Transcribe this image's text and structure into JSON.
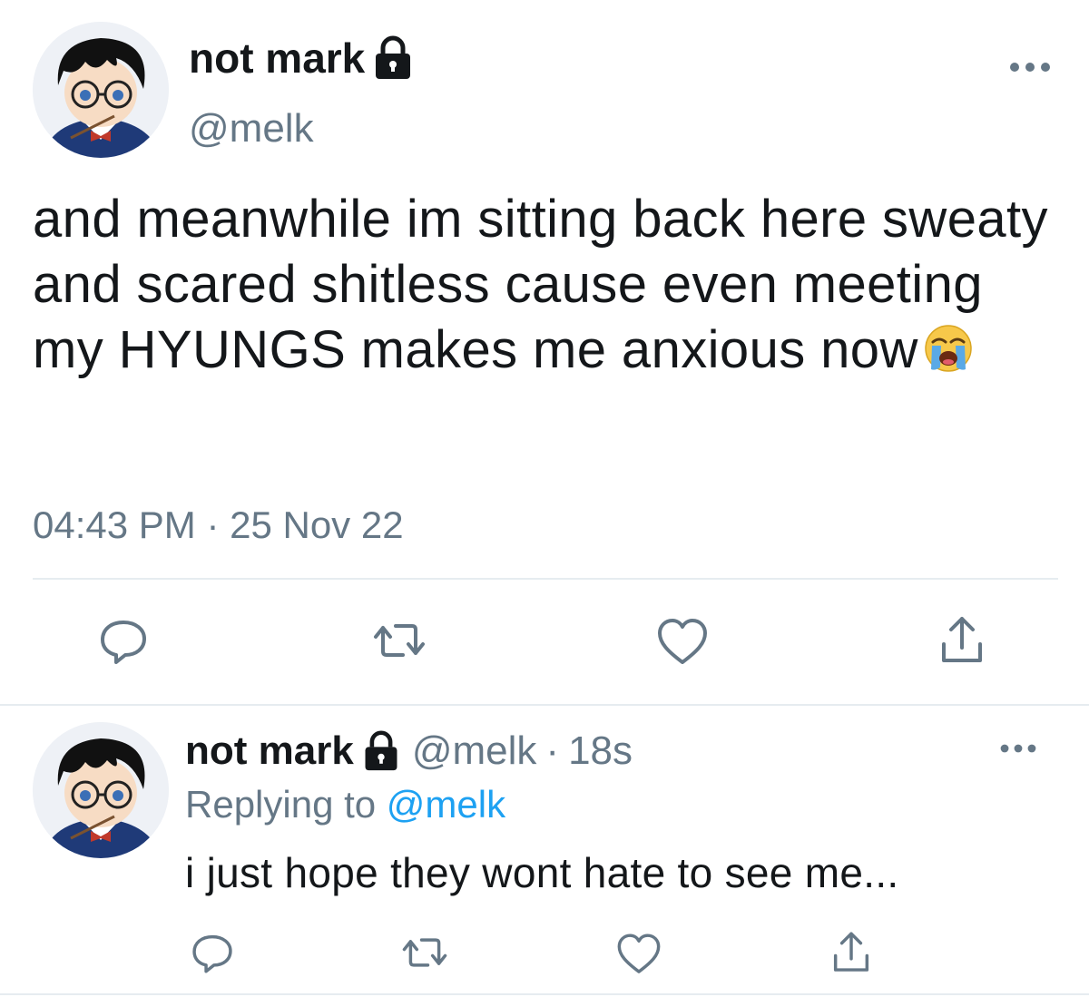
{
  "main_tweet": {
    "display_name": "not mark",
    "handle": "@melk",
    "text": "and meanwhile im sitting back here sweaty and scared shitless cause even meeting my HYUNGS makes me anxious now",
    "emoji": "😭",
    "timestamp": "04:43 PM · 25 Nov 22",
    "icons": {
      "lock": "lock-icon",
      "more": "more-horizontal-icon",
      "reply": "reply-icon",
      "retweet": "retweet-icon",
      "like": "heart-icon",
      "share": "share-icon"
    }
  },
  "reply_tweet": {
    "display_name": "not mark",
    "handle": "@melk",
    "separator": "·",
    "time_ago": "18s",
    "replying_to_label": "Replying to",
    "replying_to_handle": "@melk",
    "text": "i just hope they wont hate to see me..."
  },
  "colors": {
    "text_primary": "#14171a",
    "text_secondary": "#657786",
    "link": "#1da1f2",
    "divider": "#e6ecf0"
  }
}
